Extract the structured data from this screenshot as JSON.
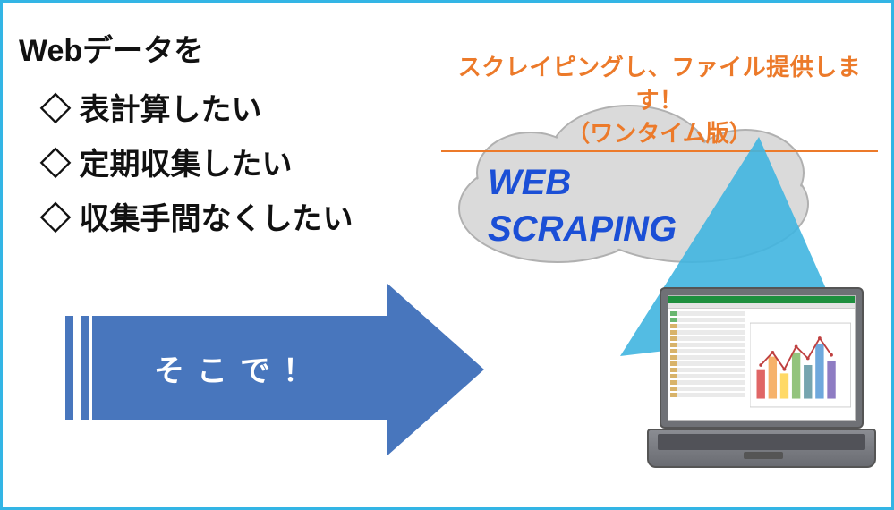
{
  "left": {
    "title": "Webデータを",
    "items": [
      "◇ 表計算したい",
      "◇ 定期収集したい",
      "◇ 収集手間なくしたい"
    ]
  },
  "orange": {
    "line1": "スクレイピングし、ファイル提供します！",
    "line2": "（ワンタイム版）"
  },
  "ws": {
    "line1": "WEB",
    "line2": "SCRAPING"
  },
  "arrow": {
    "label": "そこで！"
  },
  "colors": {
    "border": "#33b5e5",
    "orange": "#ec7a2a",
    "wsBlue": "#1b4fd6",
    "arrowBlue": "#4876bd",
    "cloudFill": "#dadada",
    "cloudEdge": "#b0b0b0",
    "beam": "#40b5e0",
    "ssGreen": "#1e8f3e"
  }
}
